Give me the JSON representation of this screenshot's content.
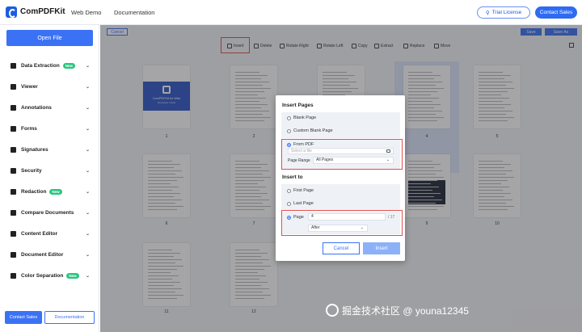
{
  "header": {
    "logo_text": "ComPDFKit",
    "nav": [
      "Web Demo",
      "Documentation"
    ],
    "trial_label": "Trial License",
    "sales_label": "Contact Sales"
  },
  "sidebar": {
    "open_label": "Open File",
    "items": [
      {
        "label": "Data Extraction",
        "icon": "data-extraction-icon",
        "badge": "New"
      },
      {
        "label": "Viewer",
        "icon": "viewer-icon",
        "badge": ""
      },
      {
        "label": "Annotations",
        "icon": "annotation-icon",
        "badge": ""
      },
      {
        "label": "Forms",
        "icon": "forms-icon",
        "badge": ""
      },
      {
        "label": "Signatures",
        "icon": "signature-icon",
        "badge": ""
      },
      {
        "label": "Security",
        "icon": "shield-icon",
        "badge": ""
      },
      {
        "label": "Redaction",
        "icon": "redaction-icon",
        "badge": "New"
      },
      {
        "label": "Compare Documents",
        "icon": "compare-icon",
        "badge": ""
      },
      {
        "label": "Content Editor",
        "icon": "content-editor-icon",
        "badge": ""
      },
      {
        "label": "Document Editor",
        "icon": "document-editor-icon",
        "badge": ""
      },
      {
        "label": "Color Separation",
        "icon": "color-separation-icon",
        "badge": "New"
      }
    ],
    "contact_label": "Contact Sales",
    "doc_label": "Documentation"
  },
  "toolbar": {
    "cancel_label": "Cancel",
    "save_label": "Save",
    "save_as_label": "Save As",
    "tools": [
      "Insert",
      "Delete",
      "Rotate Right",
      "Rotate Left",
      "Copy",
      "Extract",
      "Replace",
      "Move"
    ]
  },
  "pages": {
    "numbers": [
      "1",
      "2",
      "3",
      "4",
      "5",
      "6",
      "7",
      "8",
      "9",
      "10",
      "11",
      "12"
    ],
    "cover_title": "ComPDFKit for Web",
    "cover_subtitle": "Developer Guide"
  },
  "modal": {
    "insert_pages_heading": "Insert Pages",
    "blank_page": "Blank Page",
    "custom_blank_page": "Custom Blank Page",
    "from_pdf": "From PDF",
    "file_placeholder": "Select a file",
    "page_range_label": "Page Range",
    "page_range_value": "All Pages",
    "insert_to_heading": "Insert to",
    "first_page": "First Page",
    "last_page": "Last Page",
    "page_label": "Page",
    "page_value": "4",
    "page_total": "/ 17",
    "position_value": "After",
    "cancel_label": "Cancel",
    "insert_label": "Insert"
  },
  "watermark": {
    "text": "掘金技术社区 @ youna12345"
  }
}
